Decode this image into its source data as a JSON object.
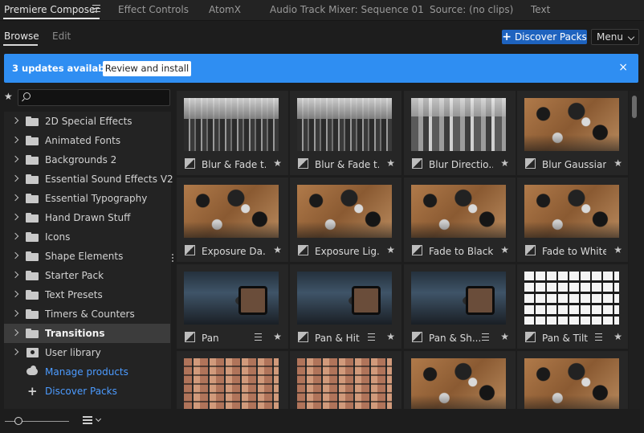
{
  "panel_tabs": [
    {
      "label": "Premiere Composer"
    },
    {
      "label": "Effect Controls"
    },
    {
      "label": "AtomX"
    },
    {
      "label": "Audio Track Mixer: Sequence 01"
    },
    {
      "label": "Source: (no clips)"
    },
    {
      "label": "Text"
    }
  ],
  "subtabs": {
    "browse": "Browse",
    "edit": "Edit"
  },
  "toolbar": {
    "discover_label": "Discover Packs",
    "menu_label": "Menu"
  },
  "banner": {
    "message": "3 updates available",
    "action_label": "Review and install",
    "close_glyph": "×"
  },
  "search": {
    "placeholder": "",
    "star_glyph": "★"
  },
  "sidebar": {
    "items": [
      {
        "label": "2D Special Effects"
      },
      {
        "label": "Animated Fonts"
      },
      {
        "label": "Backgrounds 2"
      },
      {
        "label": "Essential Sound Effects V2"
      },
      {
        "label": "Essential Typography"
      },
      {
        "label": "Hand Drawn Stuff"
      },
      {
        "label": "Icons"
      },
      {
        "label": "Shape Elements"
      },
      {
        "label": "Starter Pack"
      },
      {
        "label": "Text Presets"
      },
      {
        "label": "Timers & Counters"
      },
      {
        "label": "Transitions"
      },
      {
        "label": "User library"
      }
    ],
    "selected": "Transitions",
    "links": [
      {
        "label": "Manage products",
        "icon": "cloud-download-icon"
      },
      {
        "label": "Discover Packs",
        "icon": "plus-icon"
      }
    ]
  },
  "grid": {
    "items": [
      {
        "title": "Blur & Fade t...",
        "thumb": "mixer"
      },
      {
        "title": "Blur & Fade t...",
        "thumb": "mixer"
      },
      {
        "title": "Blur Directio...",
        "thumb": "blurdir"
      },
      {
        "title": "Blur Gaussian",
        "thumb": "desk"
      },
      {
        "title": "Exposure Da...",
        "thumb": "desk"
      },
      {
        "title": "Exposure Lig...",
        "thumb": "desk"
      },
      {
        "title": "Fade to Black",
        "thumb": "desk"
      },
      {
        "title": "Fade to White",
        "thumb": "desk"
      },
      {
        "title": "Pan",
        "thumb": "cam"
      },
      {
        "title": "Pan & Hit",
        "thumb": "cam"
      },
      {
        "title": "Pan & Sh...",
        "thumb": "cam"
      },
      {
        "title": "Pan & Tilt",
        "thumb": "keys"
      },
      {
        "title": "",
        "thumb": "board"
      },
      {
        "title": "",
        "thumb": "board"
      },
      {
        "title": "",
        "thumb": "desk"
      },
      {
        "title": "",
        "thumb": "desk"
      }
    ],
    "star_glyph": "★"
  },
  "colors": {
    "accent": "#1e63bf",
    "banner": "#2f8ef2",
    "link": "#4c9bff",
    "background": "#1d1d1d"
  }
}
